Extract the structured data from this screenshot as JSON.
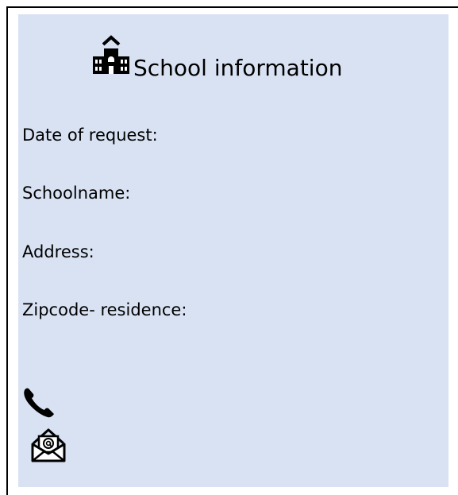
{
  "form": {
    "title": "School information",
    "fields": [
      {
        "label": "Date of request:"
      },
      {
        "label": "Schoolname:"
      },
      {
        "label": "Address:"
      },
      {
        "label": "Zipcode- residence:"
      }
    ]
  },
  "icons": {
    "school": "school-icon",
    "phone": "phone-icon",
    "email": "envelope-at-icon"
  },
  "colors": {
    "panel_background": "#d9e2f3",
    "text": "#000000"
  }
}
